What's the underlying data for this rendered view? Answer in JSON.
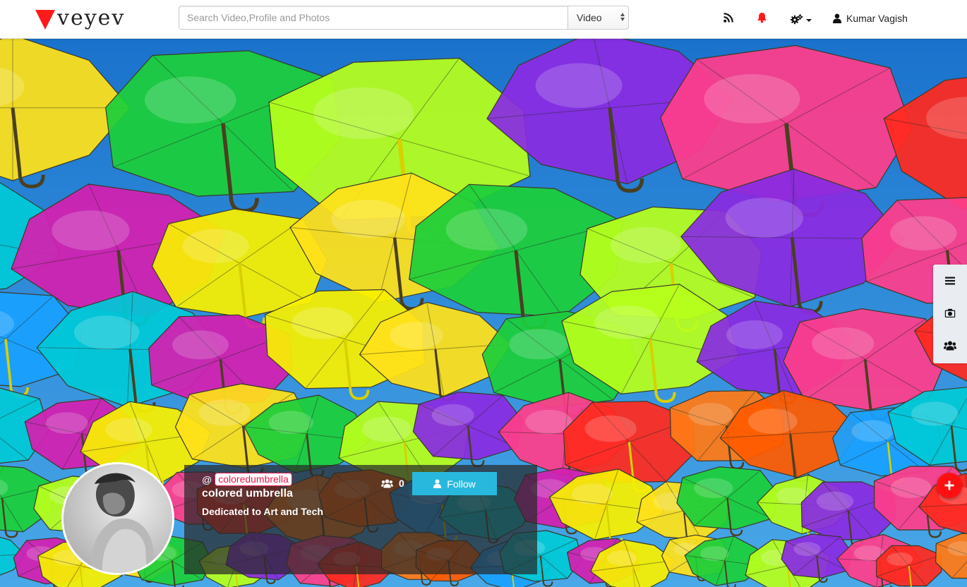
{
  "brand": {
    "name": "veyev",
    "logo_color": "#ff1a1a"
  },
  "search": {
    "placeholder": "Search Video,Profile and Photos",
    "value": "",
    "type_selected": "Video"
  },
  "nav": {
    "icons": [
      "rss-icon",
      "bell-icon",
      "gears-icon",
      "user-icon"
    ],
    "notification_color": "#ff1a1a",
    "user_name": "Kumar Vagish"
  },
  "side_toolbar": {
    "icons": [
      "menu-icon",
      "photo-camera-icon",
      "group-icon"
    ]
  },
  "fab": {
    "icon": "plus-icon",
    "color": "#ff1010"
  },
  "profile": {
    "handle_prefix": "@",
    "handle": "coloredumbrella",
    "name": "colored umbrella",
    "description": "Dedicated to Art and Tech",
    "followers_count": "0",
    "follow_label": "Follow",
    "follow_color": "#29b8dd"
  }
}
